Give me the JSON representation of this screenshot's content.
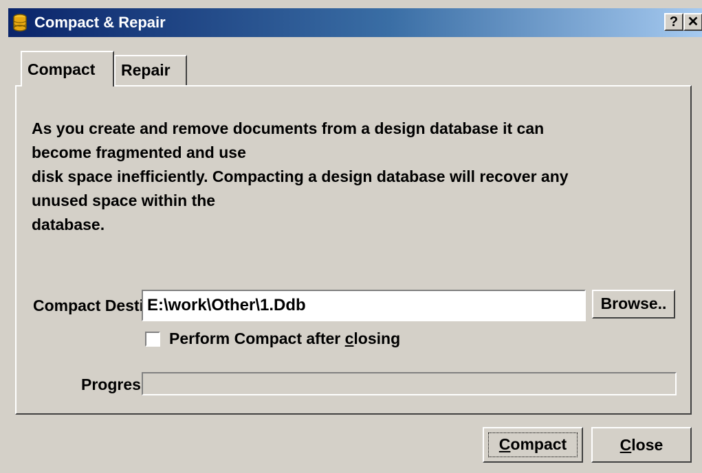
{
  "window": {
    "title": "Compact & Repair",
    "help_label": "?",
    "close_label": "✕"
  },
  "tabs": [
    {
      "label": "Compact",
      "active": true
    },
    {
      "label": "Repair",
      "active": false
    }
  ],
  "compact_tab": {
    "description_lines": [
      "As you create and remove documents from a design database it can",
      "become fragmented and use",
      "disk space inefficiently. Compacting a design database will recover any",
      "unused space within the",
      "database."
    ],
    "destination_label": "Compact Destination",
    "destination_value": "E:\\work\\Other\\1.Ddb",
    "browse_label": "Browse..",
    "checkbox_label_pre": "Perform Compact after ",
    "checkbox_label_accel": "c",
    "checkbox_label_post": "losing",
    "checkbox_checked": false,
    "progress_label": "Progress",
    "progress_value": 0
  },
  "footer": {
    "compact_accel": "C",
    "compact_rest": "ompact",
    "close_accel": "C",
    "close_rest": "lose"
  }
}
